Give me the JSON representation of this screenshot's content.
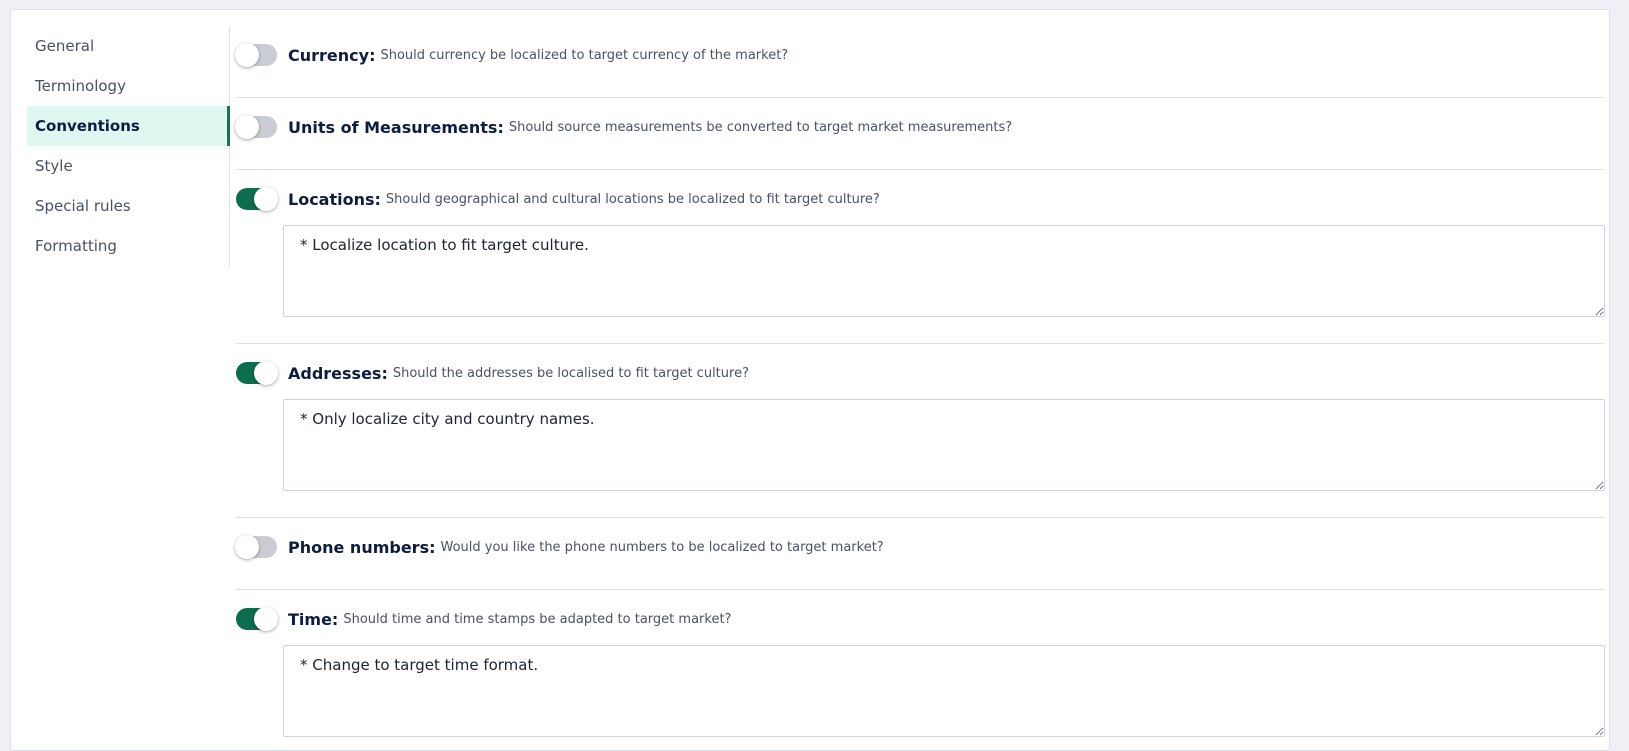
{
  "sidebar": {
    "items": [
      {
        "label": "General"
      },
      {
        "label": "Terminology"
      },
      {
        "label": "Conventions",
        "active": true
      },
      {
        "label": "Style"
      },
      {
        "label": "Special rules"
      },
      {
        "label": "Formatting"
      }
    ]
  },
  "settings": {
    "currency": {
      "label": "Currency:",
      "desc": "Should currency be localized to target currency of the market?",
      "enabled": false
    },
    "units": {
      "label": "Units of Measurements:",
      "desc": "Should source measurements be converted to target market measurements?",
      "enabled": false
    },
    "locations": {
      "label": "Locations:",
      "desc": "Should geographical and cultural locations be localized to fit target culture?",
      "enabled": true,
      "value": "* Localize location to fit target culture."
    },
    "addresses": {
      "label": "Addresses:",
      "desc": "Should the addresses be localised to fit target culture?",
      "enabled": true,
      "value": "* Only localize city and country names."
    },
    "phone": {
      "label": "Phone numbers:",
      "desc": "Would you like the phone numbers to be localized to target market?",
      "enabled": false
    },
    "time": {
      "label": "Time:",
      "desc": "Should time and time stamps be adapted to target market?",
      "enabled": true,
      "value": "* Change to target time format."
    }
  },
  "colors": {
    "accent": "#0c6e4f",
    "active_bg": "#dff7f1",
    "toggle_off": "#c9ccd3"
  }
}
